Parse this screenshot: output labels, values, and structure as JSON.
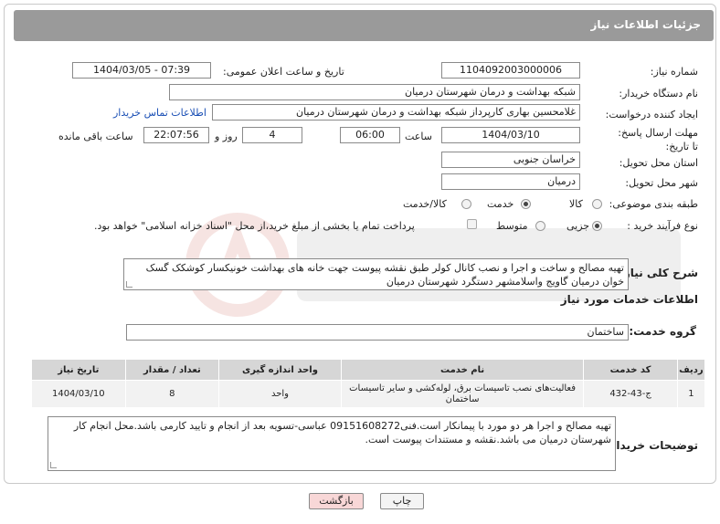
{
  "header": {
    "title": "جزئیات اطلاعات نیاز"
  },
  "fields": {
    "need_number_label": "شماره نیاز:",
    "need_number": "1104092003000006",
    "announce_label": "تاریخ و ساعت اعلان عمومی:",
    "announce_value": "1404/03/05 - 07:39",
    "buyer_label": "نام دستگاه خریدار:",
    "buyer_value": "شبکه بهداشت و درمان شهرستان درمیان",
    "creator_label": "ایجاد کننده درخواست:",
    "creator_value": "غلامحسین بهاری کارپرداز شبکه بهداشت و درمان شهرستان درمیان",
    "contact_link": "اطلاعات تماس خریدار",
    "deadline_label": "مهلت ارسال پاسخ: تا تاریخ:",
    "deadline_date": "1404/03/10",
    "time_label": "ساعت",
    "deadline_time": "06:00",
    "days_value": "4",
    "days_label": "روز و",
    "remaining_value": "22:07:56",
    "remaining_label": "ساعت باقی مانده",
    "province_label": "استان محل تحویل:",
    "province_value": "خراسان جنوبی",
    "city_label": "شهر محل تحویل:",
    "city_value": "درمیان",
    "category_label": "طبقه بندی موضوعی:",
    "category_options": [
      "کالا",
      "خدمت",
      "کالا/خدمت"
    ],
    "category_selected": "خدمت",
    "process_label": "نوع فرآیند خرید :",
    "process_options": [
      "جزیی",
      "متوسط"
    ],
    "process_selected": "جزیی",
    "payment_note": "پرداخت تمام یا بخشی از مبلغ خرید،از محل \"اسناد خزانه اسلامی\" خواهد بود."
  },
  "description": {
    "label": "شرح کلی نیاز:",
    "text": "تهیه مصالح و ساخت و اجرا و نصب  کانال کولر طبق نقشه پیوست جهت خانه های بهداشت خونیکسار کوشکک گسک  خوان درمیان گاویج واسلامشهر دستگرد شهرستان درمیان"
  },
  "services": {
    "section_title": "اطلاعات خدمات مورد نیاز",
    "group_label": "گروه خدمت:",
    "group_value": "ساختمان",
    "columns": [
      "ردیف",
      "کد خدمت",
      "نام خدمت",
      "واحد اندازه گیری",
      "تعداد / مقدار",
      "تاریخ نیاز"
    ],
    "rows": [
      [
        "1",
        "ج-43-432",
        "فعالیت‌های نصب تاسیسات برق، لوله‌کشی و سایر تاسیسات ساختمان",
        "واحد",
        "8",
        "1404/03/10"
      ]
    ]
  },
  "buyer_notes": {
    "label": "توضیحات خریدار:",
    "text": "تهیه مصالح و اجرا هر دو مورد با پیمانکار است.فنی09151608272 عباسی-تسویه بعد از انجام و تایید کارمی باشد.محل انجام کار شهرستان درمیان می باشد.نقشه و مستندات پیوست است."
  },
  "buttons": {
    "print": "چاپ",
    "back": "بازگشت"
  },
  "colors": {
    "header_bg": "#9a9a9a",
    "link": "#1a4fb5",
    "back_bg": "#f8d7d7",
    "watermark": "#c0392b"
  }
}
